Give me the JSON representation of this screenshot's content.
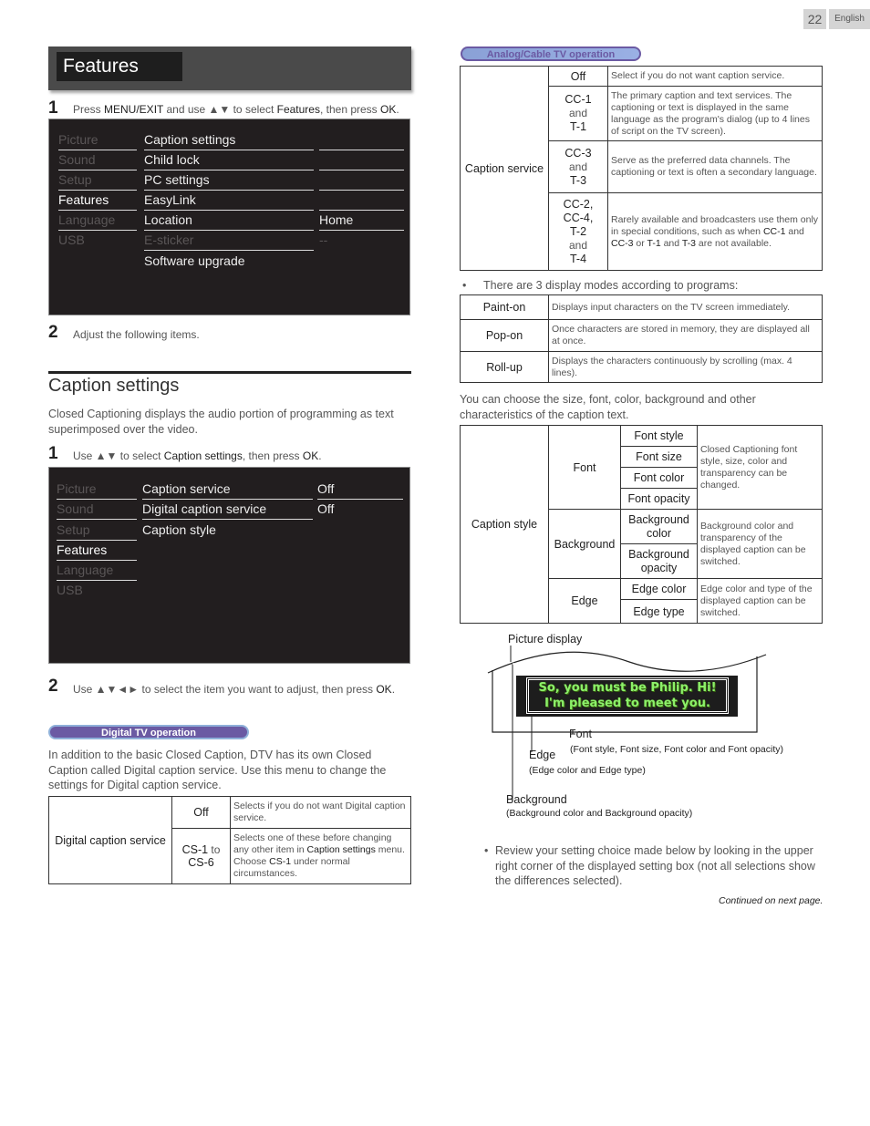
{
  "header": {
    "page_number": "22",
    "language": "English"
  },
  "features_section": {
    "title": "Features",
    "step1": {
      "num": "1",
      "parts": [
        "Press ",
        "MENU/EXIT",
        " and use ▲▼ to select ",
        "Features",
        ", then press ",
        "OK",
        "."
      ]
    },
    "menu": {
      "left": [
        {
          "label": "Picture",
          "state": "dim"
        },
        {
          "label": "Sound",
          "state": "dim"
        },
        {
          "label": "Setup",
          "state": "dim"
        },
        {
          "label": "Features",
          "state": "active"
        },
        {
          "label": "Language",
          "state": "dim"
        },
        {
          "label": "USB",
          "state": "dim"
        }
      ],
      "middle": [
        {
          "label": "Caption settings",
          "value": ""
        },
        {
          "label": "Child lock",
          "value": ""
        },
        {
          "label": "PC settings",
          "value": ""
        },
        {
          "label": "EasyLink",
          "value": ""
        },
        {
          "label": "Location",
          "value": "Home"
        },
        {
          "label": "E-sticker",
          "value": "--",
          "disabled": true
        },
        {
          "label": "Software upgrade",
          "value": ""
        }
      ]
    },
    "step2": {
      "num": "2",
      "text": "Adjust the following items."
    }
  },
  "caption_settings": {
    "title": "Caption settings",
    "intro": "Closed Captioning displays the audio portion of programming as text superimposed over the video.",
    "step1": {
      "num": "1",
      "parts": [
        "Use ▲▼ to select ",
        "Caption settings",
        ", then press ",
        "OK",
        "."
      ]
    },
    "menu": {
      "left": [
        {
          "label": "Picture",
          "state": "dim"
        },
        {
          "label": "Sound",
          "state": "dim"
        },
        {
          "label": "Setup",
          "state": "dim"
        },
        {
          "label": "Features",
          "state": "active"
        },
        {
          "label": "Language",
          "state": "dim"
        },
        {
          "label": "USB",
          "state": "dim"
        }
      ],
      "middle": [
        {
          "label": "Caption service",
          "value": "Off"
        },
        {
          "label": "Digital caption service",
          "value": "Off"
        },
        {
          "label": "Caption style",
          "value": ""
        }
      ]
    },
    "step2": {
      "num": "2",
      "text": "Use ▲▼◄► to select the item you want to adjust, then press",
      "ok": "OK",
      "end": "."
    }
  },
  "digital_tv": {
    "badge": "Digital TV operation",
    "intro": "In addition to the basic Closed Caption, DTV has its own Closed Caption called Digital caption service. Use this menu to change the settings for Digital caption service.",
    "table": {
      "row_header": "Digital caption service",
      "rows": [
        {
          "option": "Off",
          "description": "Selects if you do not want Digital caption service."
        },
        {
          "option_a": "CS-1",
          "option_join": " to ",
          "option_b": "CS-6",
          "description_parts": [
            "Selects one of these before changing any other item in ",
            "Caption settings",
            " menu. Choose ",
            "CS-1",
            " under normal circumstances."
          ]
        }
      ]
    }
  },
  "analog_tv": {
    "badge": "Analog/Cable TV operation",
    "table": {
      "row_header": "Caption service",
      "rows": [
        {
          "option_lines": [
            "Off"
          ],
          "description": "Select if you do not want caption service."
        },
        {
          "option_lines": [
            "CC-1",
            "and",
            "T-1"
          ],
          "description": "The primary caption and text services. The captioning or text is displayed in the same language as the program's dialog (up to 4 lines of script on the TV screen)."
        },
        {
          "option_lines": [
            "CC-3",
            "and",
            "T-3"
          ],
          "description": "Serve as the preferred data channels. The captioning or text is often a secondary language."
        },
        {
          "option_lines": [
            "CC-2,",
            "CC-4,",
            "T-2",
            "and",
            "T-4"
          ],
          "description_parts": [
            "Rarely available and broadcasters use them only in special conditions, such as when ",
            "CC-1",
            " and ",
            "CC-3",
            " or ",
            "T-1",
            " and ",
            "T-3",
            " are not available."
          ]
        }
      ]
    }
  },
  "display_modes": {
    "bullet": "There are 3 display modes according to programs:",
    "rows": [
      {
        "mode": "Paint-on",
        "description": "Displays input characters on the TV screen immediately."
      },
      {
        "mode": "Pop-on",
        "description": "Once characters are stored in memory, they are displayed all at once."
      },
      {
        "mode": "Roll-up",
        "description": "Displays the characters continuously by scrolling (max. 4 lines)."
      }
    ]
  },
  "caption_style": {
    "intro": "You can choose the size, font, color, background and other characteristics of the caption text.",
    "row_header": "Caption style",
    "groups": [
      {
        "name": "Font",
        "items": [
          "Font style",
          "Font size",
          "Font color",
          "Font opacity"
        ],
        "description": "Closed Captioning font style, size, color and transparency can be changed."
      },
      {
        "name": "Background",
        "items": [
          "Background color",
          "Background opacity"
        ],
        "description": "Background color and transparency of the displayed caption can be switched."
      },
      {
        "name": "Edge",
        "items": [
          "Edge color",
          "Edge type"
        ],
        "description": "Edge color and type of the displayed caption can be switched."
      }
    ]
  },
  "diagram": {
    "picture_display": "Picture display",
    "caption_line1": "So, you must be Philip. Hi!",
    "caption_line2": "I'm pleased to meet you.",
    "font_label": "Font",
    "font_sub": "(Font style, Font size, Font color and Font opacity)",
    "edge_label": "Edge",
    "edge_sub": "(Edge color and Edge type)",
    "background_label": "Background",
    "background_sub": "(Background color and Background opacity)",
    "caption_text_color": "#8cf06a"
  },
  "review_note": "Review your setting choice made below by looking in the upper right corner of the displayed setting box (not all selections show the differences selected).",
  "continued": "Continued on next page."
}
